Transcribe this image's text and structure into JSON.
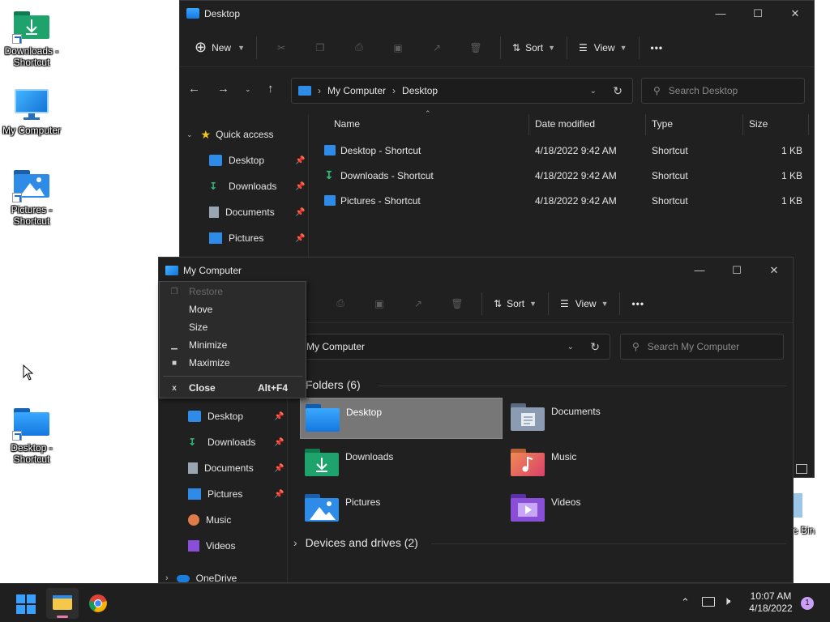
{
  "desktop": {
    "icons": [
      {
        "label": "Downloads - Shortcut",
        "icon": "downloads-folder-icon"
      },
      {
        "label": "My Computer",
        "icon": "monitor-icon"
      },
      {
        "label": "Pictures - Shortcut",
        "icon": "pictures-folder-icon"
      },
      {
        "label": "Desktop - Shortcut",
        "icon": "desktop-folder-icon"
      }
    ],
    "recycle_partial": "e Bin"
  },
  "win_back": {
    "title": "Desktop",
    "toolbar": {
      "new": "New",
      "sort": "Sort",
      "view": "View",
      "more": "•••"
    },
    "address": {
      "root": "My Computer",
      "current": "Desktop"
    },
    "search_placeholder": "Search Desktop",
    "nav": {
      "quick_access": "Quick access",
      "items": [
        "Desktop",
        "Downloads",
        "Documents",
        "Pictures"
      ]
    },
    "columns": {
      "name": "Name",
      "date": "Date modified",
      "type": "Type",
      "size": "Size"
    },
    "files": [
      {
        "name": "Desktop - Shortcut",
        "date": "4/18/2022 9:42 AM",
        "type": "Shortcut",
        "size": "1 KB"
      },
      {
        "name": "Downloads - Shortcut",
        "date": "4/18/2022 9:42 AM",
        "type": "Shortcut",
        "size": "1 KB"
      },
      {
        "name": "Pictures - Shortcut",
        "date": "4/18/2022 9:42 AM",
        "type": "Shortcut",
        "size": "1 KB"
      }
    ]
  },
  "win_front": {
    "title": "My Computer",
    "toolbar": {
      "sort": "Sort",
      "view": "View",
      "more": "•••"
    },
    "address": "My Computer",
    "search_placeholder": "Search My Computer",
    "nav": [
      "Desktop",
      "Downloads",
      "Documents",
      "Pictures",
      "Music",
      "Videos",
      "OneDrive"
    ],
    "folders_header": "Folders (6)",
    "folders": [
      {
        "name": "Desktop",
        "color": "#1e90ff"
      },
      {
        "name": "Documents",
        "color": "#7d8fa6"
      },
      {
        "name": "Downloads",
        "color": "#1ea36c"
      },
      {
        "name": "Music",
        "color": "#e07b4a"
      },
      {
        "name": "Pictures",
        "color": "#2e8ce8"
      },
      {
        "name": "Videos",
        "color": "#8a4fd8"
      }
    ],
    "devices_header": "Devices and drives (2)"
  },
  "context_menu": {
    "restore": "Restore",
    "move": "Move",
    "size": "Size",
    "minimize": "Minimize",
    "maximize": "Maximize",
    "close": "Close",
    "close_accel": "Alt+F4"
  },
  "taskbar": {
    "time": "10:07 AM",
    "date": "4/18/2022",
    "notification_count": "1"
  },
  "colors": {
    "accent": "#0a84ff",
    "window_bg": "#202020",
    "selection": "#777777"
  }
}
